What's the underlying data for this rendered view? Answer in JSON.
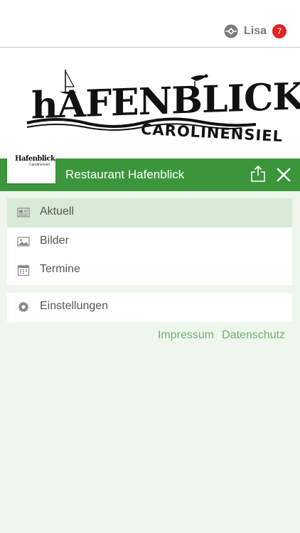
{
  "header": {
    "user_name": "Lisa",
    "notification_count": "7",
    "user_icon": "ehlo-logo-icon"
  },
  "hero": {
    "logo_title": "HAFENBLICK",
    "logo_subtitle": "CAROLINENSIEL"
  },
  "titlebar": {
    "thumb_title": "Hafenblick",
    "thumb_subtitle": "Carolinensiel",
    "title": "Restaurant Hafenblick",
    "share_icon": "share-icon",
    "close_icon": "close-icon"
  },
  "menu": {
    "items": [
      {
        "label": "Aktuell",
        "icon": "newspaper-icon",
        "active": true
      },
      {
        "label": "Bilder",
        "icon": "image-icon",
        "active": false
      },
      {
        "label": "Termine",
        "icon": "calendar-icon",
        "active": false
      }
    ],
    "settings": {
      "label": "Einstellungen",
      "icon": "gear-icon"
    }
  },
  "footer": {
    "impressum": "Impressum",
    "datenschutz": "Datenschutz"
  },
  "colors": {
    "brand_green": "#3b963b",
    "active_item": "#d7ebd6",
    "background": "#eef6ed",
    "badge_red": "#e02323",
    "link_green": "#6fb06f"
  }
}
